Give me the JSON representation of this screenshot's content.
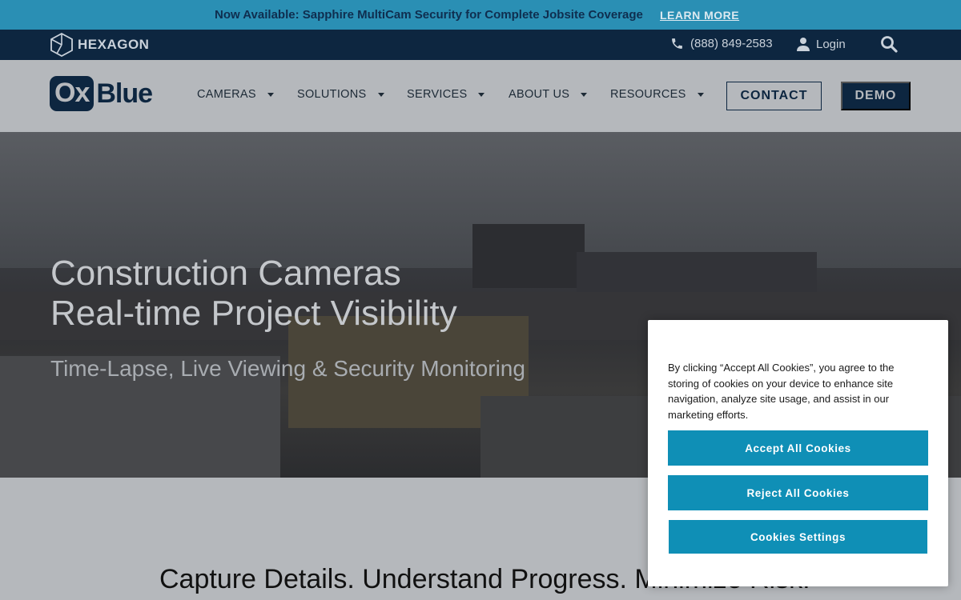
{
  "announcement": {
    "text": "Now Available: Sapphire MultiCam Security for Complete Jobsite Coverage",
    "link": "LEARN MORE"
  },
  "utility": {
    "brand": "HEXAGON",
    "phone": "(888) 849-2583",
    "login": "Login"
  },
  "nav": {
    "brand_ox": "Ox",
    "brand_blue": "Blue",
    "items": [
      {
        "label": "CAMERAS"
      },
      {
        "label": "SOLUTIONS"
      },
      {
        "label": "SERVICES"
      },
      {
        "label": "ABOUT US"
      },
      {
        "label": "RESOURCES"
      }
    ],
    "contact": "CONTACT",
    "demo": "DEMO"
  },
  "hero": {
    "title_line1": "Construction Cameras",
    "title_line2": "Real-time Project Visibility",
    "subtitle": "Time-Lapse, Live Viewing & Security Monitoring"
  },
  "section": {
    "title": "Capture Details. Understand Progress. Minimize Risk."
  },
  "cookie": {
    "text": "By clicking “Accept All Cookies”, you agree to the storing of cookies on your device to enhance site navigation, analyze site usage, and assist in our marketing efforts.",
    "accept": "Accept All Cookies",
    "reject": "Reject All Cookies",
    "settings": "Cookies Settings"
  },
  "colors": {
    "accent": "#0f8fb6",
    "navy": "#0d2640",
    "announce": "#2a8fb4"
  }
}
